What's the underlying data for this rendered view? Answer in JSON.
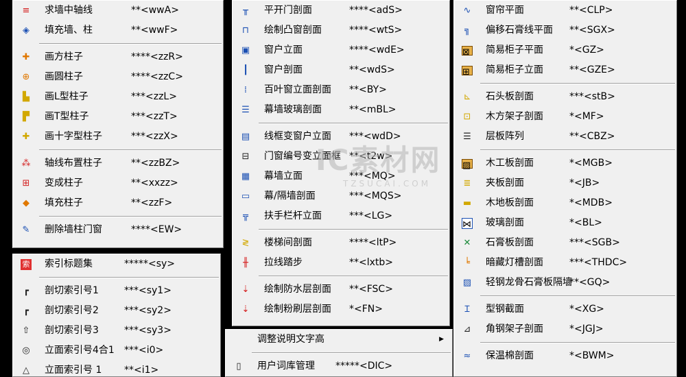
{
  "menu1": [
    {
      "icon": "wall-axis-icon",
      "label": "求墙中轴线",
      "shortcut": "**<wwA>"
    },
    {
      "icon": "fill-wall-icon",
      "label": "填充墙、柱",
      "shortcut": "**<wwF>"
    },
    {
      "sep": true
    },
    {
      "icon": "square-column-icon",
      "label": "画方柱子",
      "shortcut": "****<zzR>"
    },
    {
      "icon": "round-column-icon",
      "label": "画圆柱子",
      "shortcut": "****<zzC>"
    },
    {
      "icon": "l-column-icon",
      "label": "画L型柱子",
      "shortcut": "***<zzL>"
    },
    {
      "icon": "t-column-icon",
      "label": "画T型柱子",
      "shortcut": "***<zzT>"
    },
    {
      "icon": "cross-column-icon",
      "label": "画十字型柱子",
      "shortcut": "***<zzX>"
    },
    {
      "sep": true
    },
    {
      "icon": "axis-columns-icon",
      "label": "轴线布置柱子",
      "shortcut": "**<zzBZ>"
    },
    {
      "icon": "change-column-icon",
      "label": "变成柱子",
      "shortcut": "**<xxzz>"
    },
    {
      "icon": "fill-column-icon",
      "label": "填充柱子",
      "shortcut": "**<zzF>"
    },
    {
      "sep": true
    },
    {
      "icon": "delete-wall-icon",
      "label": "删除墙柱门窗",
      "shortcut": "****<EW>"
    }
  ],
  "menu2": [
    {
      "icon": "index-title-icon",
      "label": "索引标题集",
      "shortcut": "*****<sy>"
    },
    {
      "sep": true
    },
    {
      "icon": "section-index1-icon",
      "label": "剖切索引号1",
      "shortcut": "***<sy1>"
    },
    {
      "icon": "section-index2-icon",
      "label": "剖切索引号2",
      "shortcut": "***<sy2>"
    },
    {
      "icon": "section-index3-icon",
      "label": "剖切索引号3",
      "shortcut": "***<sy3>"
    },
    {
      "icon": "elevation-index4-icon",
      "label": "立面索引号4合1",
      "shortcut": "***<i0>"
    },
    {
      "icon": "elevation-index1-icon",
      "label": "立面索引号 1",
      "shortcut": "**<i1>"
    }
  ],
  "menu3": [
    {
      "icon": "flat-door-icon",
      "label": "平开门剖面",
      "shortcut": "****<adS>"
    },
    {
      "icon": "bay-window-icon",
      "label": "绘制凸窗剖面",
      "shortcut": "****<wtS>"
    },
    {
      "icon": "window-elev-icon",
      "label": "窗户立面",
      "shortcut": "****<wdE>"
    },
    {
      "icon": "window-section-icon",
      "label": "窗户剖面",
      "shortcut": "**<wdS>"
    },
    {
      "icon": "louver-icon",
      "label": "百叶窗立面剖面",
      "shortcut": "**<BY>"
    },
    {
      "icon": "curtain-glass-icon",
      "label": "幕墙玻璃剖面",
      "shortcut": "**<mBL>"
    },
    {
      "sep": true
    },
    {
      "icon": "frame-window-icon",
      "label": "线框变窗户立面",
      "shortcut": "***<wdD>"
    },
    {
      "icon": "door-number-icon",
      "label": "门窗编号变立面框",
      "shortcut": "**<t2w>"
    },
    {
      "icon": "curtain-elev-icon",
      "label": "幕墙立面",
      "shortcut": "***<MQ>"
    },
    {
      "icon": "partition-icon",
      "label": "幕/隔墙剖面",
      "shortcut": "***<MQS>"
    },
    {
      "icon": "railing-icon",
      "label": "扶手栏杆立面",
      "shortcut": "***<LG>"
    },
    {
      "sep": true
    },
    {
      "icon": "stair-icon",
      "label": "楼梯间剖面",
      "shortcut": "****<ltP>"
    },
    {
      "icon": "step-icon",
      "label": "拉线踏步",
      "shortcut": "**<lxtb>"
    },
    {
      "sep": true
    },
    {
      "icon": "waterproof-icon",
      "label": "绘制防水层剖面",
      "shortcut": "**<FSC>"
    },
    {
      "icon": "plaster-icon",
      "label": "绘制粉刷层剖面",
      "shortcut": "*<FN>"
    }
  ],
  "menu4": [
    {
      "icon": "text-height-icon",
      "label": "调整说明文字高",
      "submenu": true
    },
    {
      "sep": true
    },
    {
      "icon": "dictionary-icon",
      "label": "用户词库管理",
      "shortcut": "*****<DIC>"
    }
  ],
  "menu5": [
    {
      "icon": "curtain-plan-icon",
      "label": "窗帘平面",
      "shortcut": "**<CLP>"
    },
    {
      "icon": "offset-gypsum-icon",
      "label": "偏移石膏线平面",
      "shortcut": "**<SGX>"
    },
    {
      "icon": "cabinet-plan-icon",
      "label": "简易柜子平面",
      "shortcut": "*<GZ>"
    },
    {
      "icon": "cabinet-elev-icon",
      "label": "简易柜子立面",
      "shortcut": "**<GZE>"
    },
    {
      "sep": true
    },
    {
      "icon": "stone-section-icon",
      "label": "石头板剖面",
      "shortcut": "***<stB>"
    },
    {
      "icon": "wood-frame-icon",
      "label": "木方架子剖面",
      "shortcut": "*<MF>"
    },
    {
      "icon": "layer-array-icon",
      "label": "层板阵列",
      "shortcut": "**<CBZ>"
    },
    {
      "sep": true
    },
    {
      "icon": "wood-board-icon",
      "label": "木工板剖面",
      "shortcut": "*<MGB>"
    },
    {
      "icon": "plywood-icon",
      "label": "夹板剖面",
      "shortcut": "*<JB>"
    },
    {
      "icon": "floor-board-icon",
      "label": "木地板剖面",
      "shortcut": "*<MDB>"
    },
    {
      "icon": "glass-icon",
      "label": "玻璃剖面",
      "shortcut": "*<BL>"
    },
    {
      "icon": "gypsum-board-icon",
      "label": "石膏板剖面",
      "shortcut": "***<SGB>"
    },
    {
      "icon": "light-trough-icon",
      "label": "暗藏灯槽剖面",
      "shortcut": "***<THDC>"
    },
    {
      "icon": "steel-keel-icon",
      "label": "轻钢龙骨石膏板隔墙",
      "shortcut": "**<GQ>"
    },
    {
      "sep": true
    },
    {
      "icon": "steel-section-icon",
      "label": "型钢截面",
      "shortcut": "*<XG>"
    },
    {
      "icon": "angle-frame-icon",
      "label": "角钢架子剖面",
      "shortcut": "*<JGJ>"
    },
    {
      "sep": true
    },
    {
      "icon": "insulation-icon",
      "label": "保温棉剖面",
      "shortcut": "*<BWM>"
    }
  ],
  "watermark": {
    "cn": "IC素材网",
    "en": "TZSUCAI.COM"
  }
}
